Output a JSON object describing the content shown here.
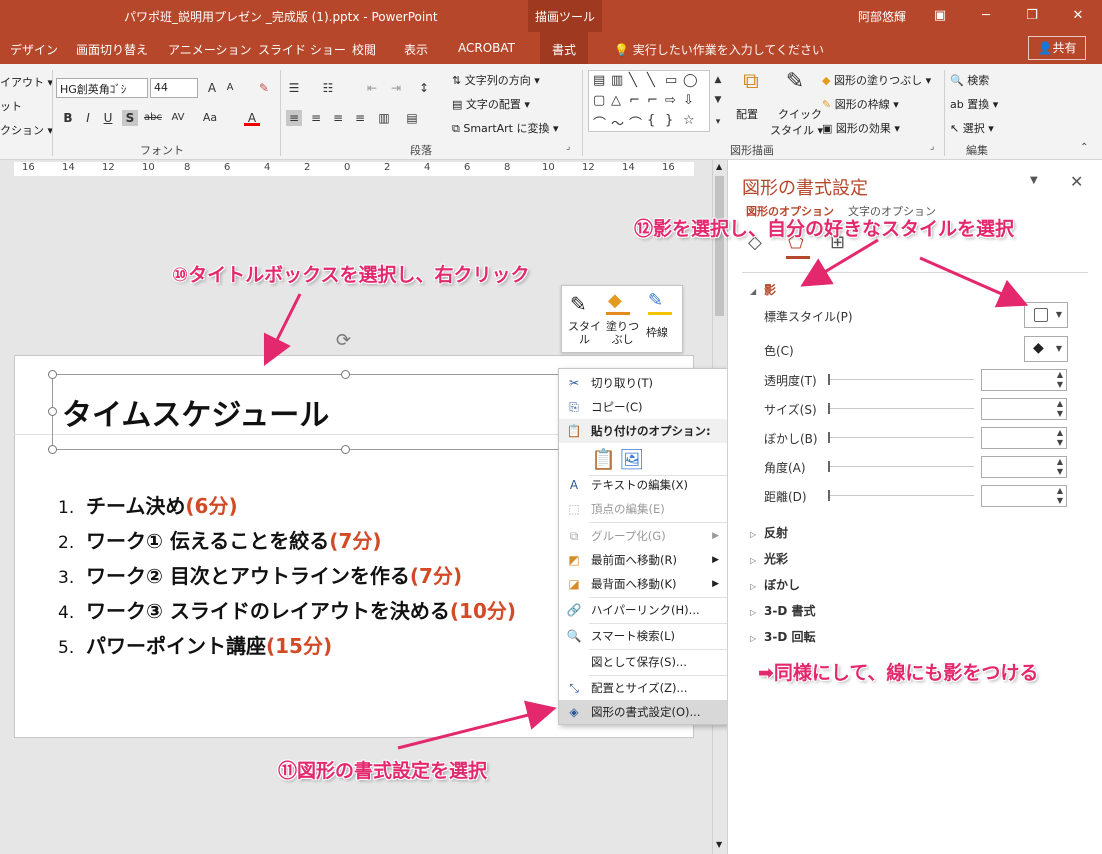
{
  "window": {
    "title": "パワポ班_説明用プレゼン _完成版 (1).pptx - PowerPoint",
    "context_tab_group": "描画ツール",
    "user": "阿部悠輝",
    "minimize": "─",
    "restore": "❐",
    "close": "✕",
    "ribbon_display": "▣"
  },
  "tabs": {
    "design": "デザイン",
    "transitions": "画面切り替え",
    "animations": "アニメーション",
    "slideshow": "スライド ショー",
    "review": "校閲",
    "view": "表示",
    "acrobat": "ACROBAT",
    "format": "書式",
    "tell_me": "実行したい作業を入力してください",
    "share": "共有"
  },
  "ribbon": {
    "layout": "イアウト ▾",
    "reset": "ット",
    "section": "クション ▾",
    "font_name": "HG創英角ｺﾞｼ",
    "font_size": "44",
    "font_group": "フォント",
    "paragraph_group": "段落",
    "text_direction": "文字列の方向 ▾",
    "align_text": "文字の配置 ▾",
    "smartart": "SmartArt に変換 ▾",
    "drawing_group": "図形描画",
    "arrange": "配置",
    "quick_styles_1": "クイック",
    "quick_styles_2": "スタイル ▾",
    "shape_fill": "図形の塗りつぶし ▾",
    "shape_outline": "図形の枠線 ▾",
    "shape_effects": "図形の効果 ▾",
    "find": "検索",
    "replace": "置換 ▾",
    "select": "選択 ▾",
    "editing_group": "編集"
  },
  "ruler": [
    "16",
    "14",
    "12",
    "10",
    "8",
    "6",
    "4",
    "2",
    "0",
    "2",
    "4",
    "6",
    "8",
    "10",
    "12",
    "14",
    "16"
  ],
  "slide": {
    "title": "タイムスケジュール",
    "items": [
      {
        "num": "1.",
        "text": "チーム決め",
        "time": "(6分)"
      },
      {
        "num": "2.",
        "text": "ワーク① 伝えることを絞る",
        "time": "(7分)"
      },
      {
        "num": "3.",
        "text": "ワーク② 目次とアウトラインを作る",
        "time": "(7分)"
      },
      {
        "num": "4.",
        "text": "ワーク③ スライドのレイアウトを決める",
        "time": "(10分)"
      },
      {
        "num": "5.",
        "text": "パワーポイント講座",
        "time": "(15分)"
      }
    ]
  },
  "minibar": {
    "style_1": "スタイ",
    "style_2": "ル",
    "fill_1": "塗りつ",
    "fill_2": "ぶし",
    "outline": "枠線"
  },
  "context_menu": {
    "cut": "切り取り(T)",
    "copy": "コピー(C)",
    "paste_options": "貼り付けのオプション:",
    "edit_text": "テキストの編集(X)",
    "edit_points": "頂点の編集(E)",
    "group": "グループ化(G)",
    "bring_front": "最前面へ移動(R)",
    "send_back": "最背面へ移動(K)",
    "hyperlink": "ハイパーリンク(H)...",
    "smart_lookup": "スマート検索(L)",
    "save_as_picture": "図として保存(S)...",
    "size_position": "配置とサイズ(Z)...",
    "format_shape": "図形の書式設定(O)..."
  },
  "pane": {
    "title": "図形の書式設定",
    "tab_shape_options": "図形のオプション",
    "tab_text_options": "文字のオプション",
    "shadow_section": "影",
    "presets": "標準スタイル(P)",
    "color": "色(C)",
    "transparency": "透明度(T)",
    "size": "サイズ(S)",
    "blur": "ぼかし(B)",
    "angle": "角度(A)",
    "distance": "距離(D)",
    "reflection": "反射",
    "glow": "光彩",
    "soft_edges": "ぼかし",
    "format_3d": "3-D 書式",
    "rotation_3d": "3-D 回転"
  },
  "annotations": {
    "step10": "⑩タイトルボックスを選択し、右クリック",
    "step11": "⑪図形の書式設定を選択",
    "step12": "⑫影を選択し、自分の好きなスタイルを選択",
    "note": "➡同様にして、線にも影をつける"
  },
  "colors": {
    "accent": "#b7472a",
    "annotation": "#e4286e",
    "time_text": "#d24a26"
  }
}
